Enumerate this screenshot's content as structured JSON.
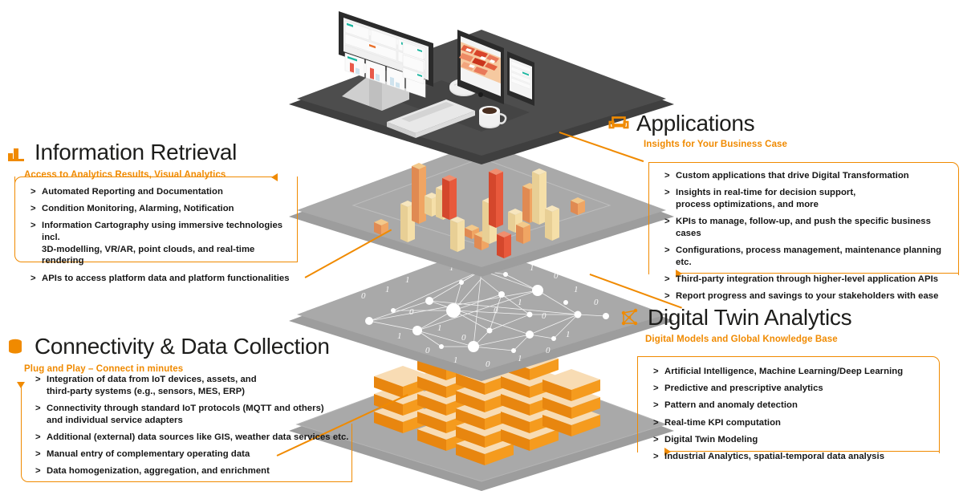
{
  "page": {
    "accent": "#F08A00",
    "accent_dark": "#E87200",
    "title_color": "#1d1d1b"
  },
  "sections": [
    {
      "id": "information-retrieval",
      "icon": "bar-chart-icon",
      "title": "Information Retrieval",
      "subtitle": "Access to Analytics Results, Visual Analytics",
      "bullets": [
        "Automated Reporting and Documentation",
        "Condition Monitoring, Alarming, Notification",
        "Information Cartography using immersive technologies incl.\n3D-modelling, VR/AR, point clouds, and real-time rendering",
        "APIs to access platform data and platform functionalities"
      ]
    },
    {
      "id": "applications",
      "icon": "application-window-icon",
      "title": "Applications",
      "subtitle": "Insights for Your Business Case",
      "bullets": [
        "Custom applications that drive Digital Transformation",
        "Insights in real-time for decision support,\nprocess optimizations, and more",
        "KPIs to manage, follow-up, and push the specific business cases",
        "Configurations, process management, maintenance planning etc.",
        "Third-party integration through higher-level application APIs",
        "Report progress and savings to your stakeholders with ease"
      ]
    },
    {
      "id": "connectivity-data-collection",
      "icon": "database-stack-icon",
      "title": "Connectivity & Data Collection",
      "subtitle": "Plug and Play – Connect in minutes",
      "bullets": [
        "Integration of data from IoT devices, assets, and\nthird-party systems (e.g., sensors, MES, ERP)",
        "Connectivity through standard IoT protocols (MQTT and others)\nand individual service adapters",
        "Additional (external) data sources like GIS, weather data services etc.",
        "Manual entry of complementary operating data",
        "Data homogenization, aggregation, and enrichment"
      ]
    },
    {
      "id": "digital-twin-analytics",
      "icon": "network-graph-icon",
      "title": "Digital Twin Analytics",
      "subtitle": "Digital Models and Global Knowledge Base",
      "bullets": [
        "Artificial Intelligence, Machine Learning/Deep Learning",
        "Predictive and prescriptive analytics",
        "Pattern and anomaly detection",
        "Real-time KPI computation",
        "Digital Twin Modeling",
        "Industrial Analytics, spatial-temporal data analysis"
      ]
    }
  ],
  "illustration": {
    "layers": [
      {
        "name": "devices-layer",
        "description": "Dark platform with desktop monitor, keyboard, mouse, tablet, smartphone and coffee mug",
        "color": "#4d4d4d"
      },
      {
        "name": "analytics-bars-layer",
        "description": "Gray platform with 3D bar chart columns",
        "color": "#a6a6a6"
      },
      {
        "name": "knowledge-graph-layer",
        "description": "Gray platform with network graph nodes, edges and binary digits",
        "color": "#a6a6a6"
      },
      {
        "name": "data-sources-layer",
        "description": "Gray platform with stacked orange server boxes",
        "color": "#a6a6a6"
      }
    ],
    "bar_colors": [
      "#F5DFA8",
      "#F0A563",
      "#E8593C",
      "#F3C98B"
    ],
    "box_colors": [
      "#F59B1E",
      "#FAD9AF",
      "#D97F12"
    ]
  }
}
